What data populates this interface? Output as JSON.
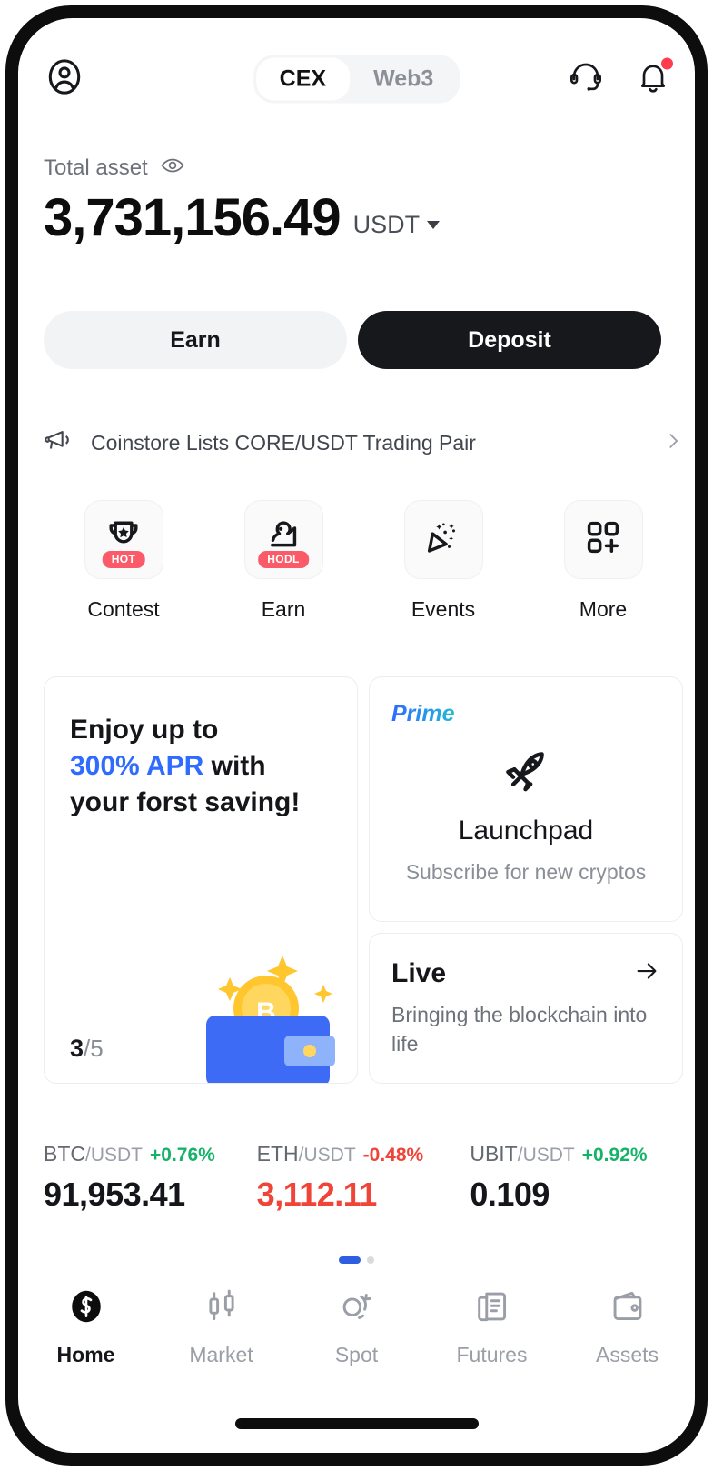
{
  "header": {
    "avatar_icon": "user-circle-icon",
    "tabs": [
      {
        "label": "CEX",
        "active": true
      },
      {
        "label": "Web3",
        "active": false
      }
    ],
    "support_icon": "headset-icon",
    "notification_icon": "bell-icon",
    "notification_has_badge": true
  },
  "balance": {
    "label": "Total asset",
    "eye_icon": "eye-icon",
    "amount": "3,731,156.49",
    "currency": "USDT",
    "currency_caret_icon": "caret-down-icon"
  },
  "actions": {
    "earn_label": "Earn",
    "deposit_label": "Deposit"
  },
  "announcement": {
    "icon": "megaphone-icon",
    "text": "Coinstore Lists CORE/USDT Trading Pair",
    "chevron_icon": "chevron-right-icon"
  },
  "quick_actions": [
    {
      "label": "Contest",
      "icon": "trophy-icon",
      "badge": "HOT"
    },
    {
      "label": "Earn",
      "icon": "piggy-hand-icon",
      "badge": "HODL"
    },
    {
      "label": "Events",
      "icon": "confetti-icon",
      "badge": ""
    },
    {
      "label": "More",
      "icon": "grid-plus-icon",
      "badge": ""
    }
  ],
  "promo_card": {
    "line1": "Enjoy up to",
    "highlight": "300% APR",
    "line2_tail": " with",
    "line3": "your forst saving!",
    "highlight_color": "#2f6bff",
    "counter_current": "3",
    "counter_total": "/5",
    "art_icon": "wallet-bitcoin-illustration"
  },
  "launchpad_card": {
    "badge": "Prime",
    "icon": "rocket-icon",
    "title": "Launchpad",
    "subtitle": "Subscribe for new cryptos"
  },
  "live_card": {
    "title": "Live",
    "arrow_icon": "arrow-right-icon",
    "subtitle": "Bringing the blockchain into life"
  },
  "tickers": [
    {
      "base": "BTC",
      "quote": "/USDT",
      "change": "+0.76%",
      "direction": "up",
      "price": "91,953.41",
      "price_style": "neutral"
    },
    {
      "base": "ETH",
      "quote": "/USDT",
      "change": "-0.48%",
      "direction": "down",
      "price": "3,112.11",
      "price_style": "down"
    },
    {
      "base": "UBIT",
      "quote": "/USDT",
      "change": "+0.92%",
      "direction": "up",
      "price": "0.109",
      "price_style": "neutral"
    }
  ],
  "ticker_pagination": {
    "count": 2,
    "active_index": 0,
    "active_color": "#2f5fe0"
  },
  "bottom_nav": [
    {
      "label": "Home",
      "icon": "coinstore-logo-icon",
      "active": true
    },
    {
      "label": "Market",
      "icon": "candlestick-icon",
      "active": false
    },
    {
      "label": "Spot",
      "icon": "spot-trade-icon",
      "active": false
    },
    {
      "label": "Futures",
      "icon": "futures-doc-icon",
      "active": false
    },
    {
      "label": "Assets",
      "icon": "wallet-icon",
      "active": false
    }
  ],
  "colors": {
    "up": "#17b26a",
    "down": "#f04438",
    "accent_blue": "#2f6bff",
    "dark": "#17181c",
    "badge_red": "#fb5a68"
  }
}
